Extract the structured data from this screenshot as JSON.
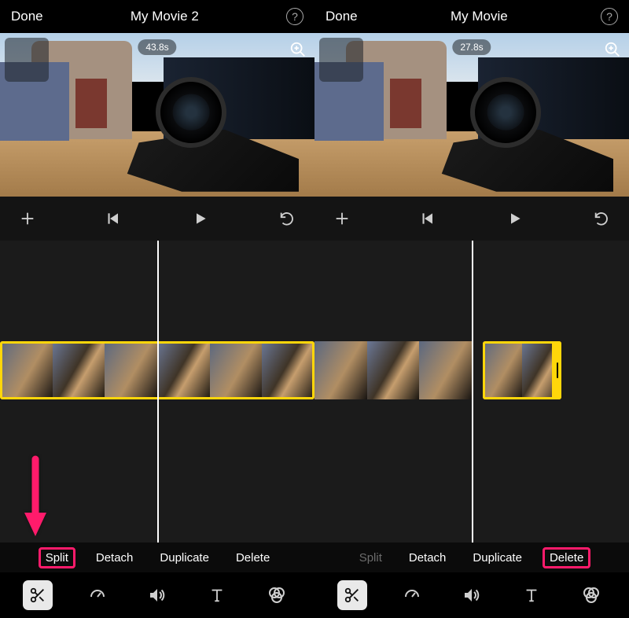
{
  "left": {
    "header": {
      "done": "Done",
      "title": "My Movie 2",
      "help": "?"
    },
    "preview": {
      "timecode": "43.8s"
    },
    "actions": {
      "split": "Split",
      "detach": "Detach",
      "duplicate": "Duplicate",
      "delete": "Delete",
      "highlighted": "split"
    },
    "tools": {
      "active": "scissors"
    }
  },
  "right": {
    "header": {
      "done": "Done",
      "title": "My Movie",
      "help": "?"
    },
    "preview": {
      "timecode": "27.8s"
    },
    "actions": {
      "split": "Split",
      "detach": "Detach",
      "duplicate": "Duplicate",
      "delete": "Delete",
      "highlighted": "delete",
      "disabled": [
        "split"
      ]
    },
    "tools": {
      "active": "scissors"
    }
  },
  "icons": {
    "add": "add-icon",
    "skip_back": "skip-back-icon",
    "play": "play-icon",
    "undo": "undo-icon",
    "zoom": "zoom-icon",
    "scissors": "scissors-icon",
    "speed": "speed-icon",
    "volume": "volume-icon",
    "text": "text-icon",
    "filters": "filters-icon"
  }
}
